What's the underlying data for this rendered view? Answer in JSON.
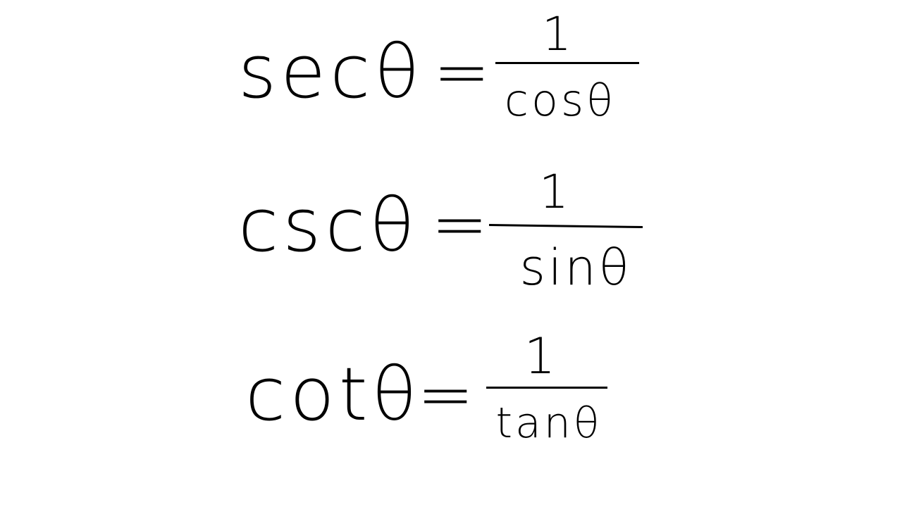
{
  "equations": [
    {
      "lhs": "secθ",
      "equals": "=",
      "numerator": "1",
      "denominator": "cosθ"
    },
    {
      "lhs": "cscθ",
      "equals": "=",
      "numerator": "1",
      "denominator": "sinθ"
    },
    {
      "lhs": "cotθ",
      "equals": "=",
      "numerator": "1",
      "denominator": "tanθ"
    }
  ]
}
